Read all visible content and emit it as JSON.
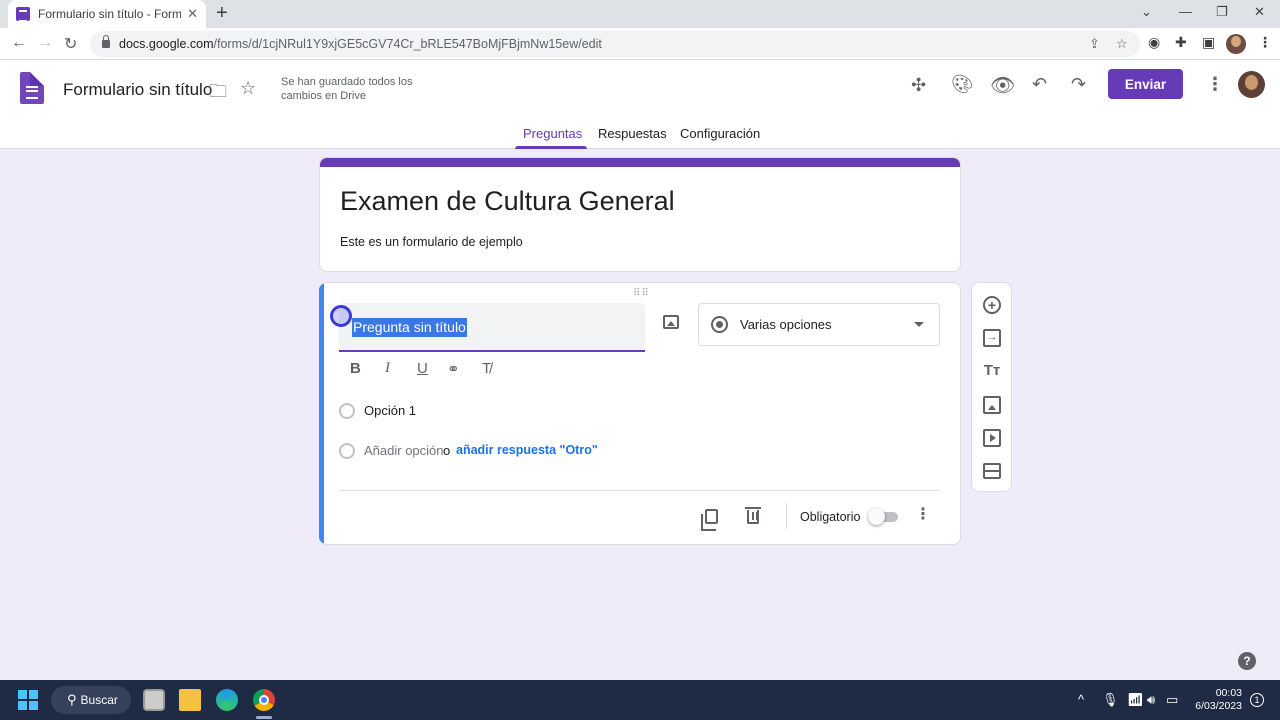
{
  "browser": {
    "tab_title": "Formulario sin título - Formulario",
    "url_host": "docs.google.com",
    "url_path": "/forms/d/1cjNRul1Y9xjGE5cGV74Cr_bRLE547BoMjFBjmNw15ew/edit"
  },
  "header": {
    "form_name": "Formulario sin título",
    "save_status": "Se han guardado todos los cambios en Drive",
    "send_label": "Enviar"
  },
  "tabs": [
    {
      "label": "Preguntas",
      "active": true
    },
    {
      "label": "Respuestas",
      "active": false
    },
    {
      "label": "Configuración",
      "active": false
    }
  ],
  "form": {
    "title": "Examen de Cultura General",
    "description": "Este es un formulario de ejemplo"
  },
  "question": {
    "title": "Pregunta sin título",
    "type": "Varias opciones",
    "options": [
      "Opción 1"
    ],
    "add_option": "Añadir opción",
    "or": "o",
    "add_other": "añadir respuesta \"Otro\"",
    "required_label": "Obligatorio",
    "required": false
  },
  "taskbar": {
    "search_label": "Buscar",
    "time": "00:03",
    "date": "6/03/2023"
  },
  "colors": {
    "brand": "#673ab7",
    "accent_blue": "#4285f4",
    "background": "#f0ebf8"
  }
}
